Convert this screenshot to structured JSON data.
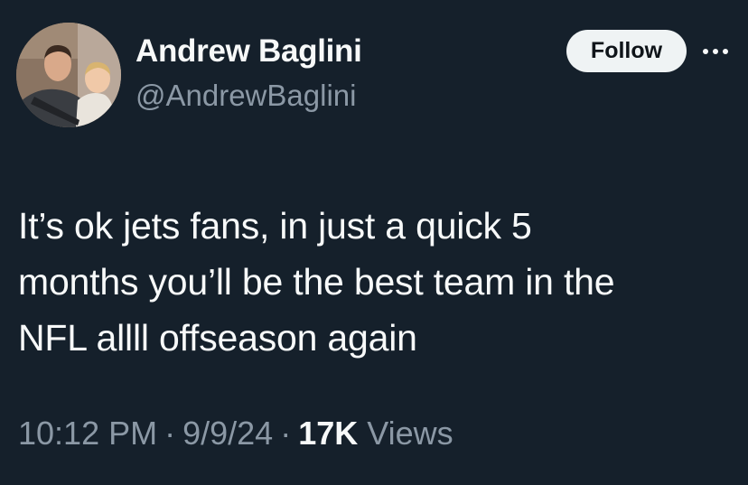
{
  "author": {
    "display_name": "Andrew Baglini",
    "handle": "@AndrewBaglini",
    "avatar_icon": "profile-photo-icon"
  },
  "actions": {
    "follow_label": "Follow",
    "more_icon": "more-horizontal-icon"
  },
  "tweet": {
    "text_lines": [
      "It’s ok jets fans, in just a quick 5",
      "months you’ll be the best team in the",
      "NFL allll offseason again"
    ]
  },
  "meta": {
    "time": "10:12 PM",
    "separator": "·",
    "date": "9/9/24",
    "views_count": "17K",
    "views_label": "Views"
  },
  "colors": {
    "background": "#15202b",
    "primary_text": "#f7f9f9",
    "secondary_text": "#8b98a5",
    "follow_button_bg": "#eff3f4"
  }
}
